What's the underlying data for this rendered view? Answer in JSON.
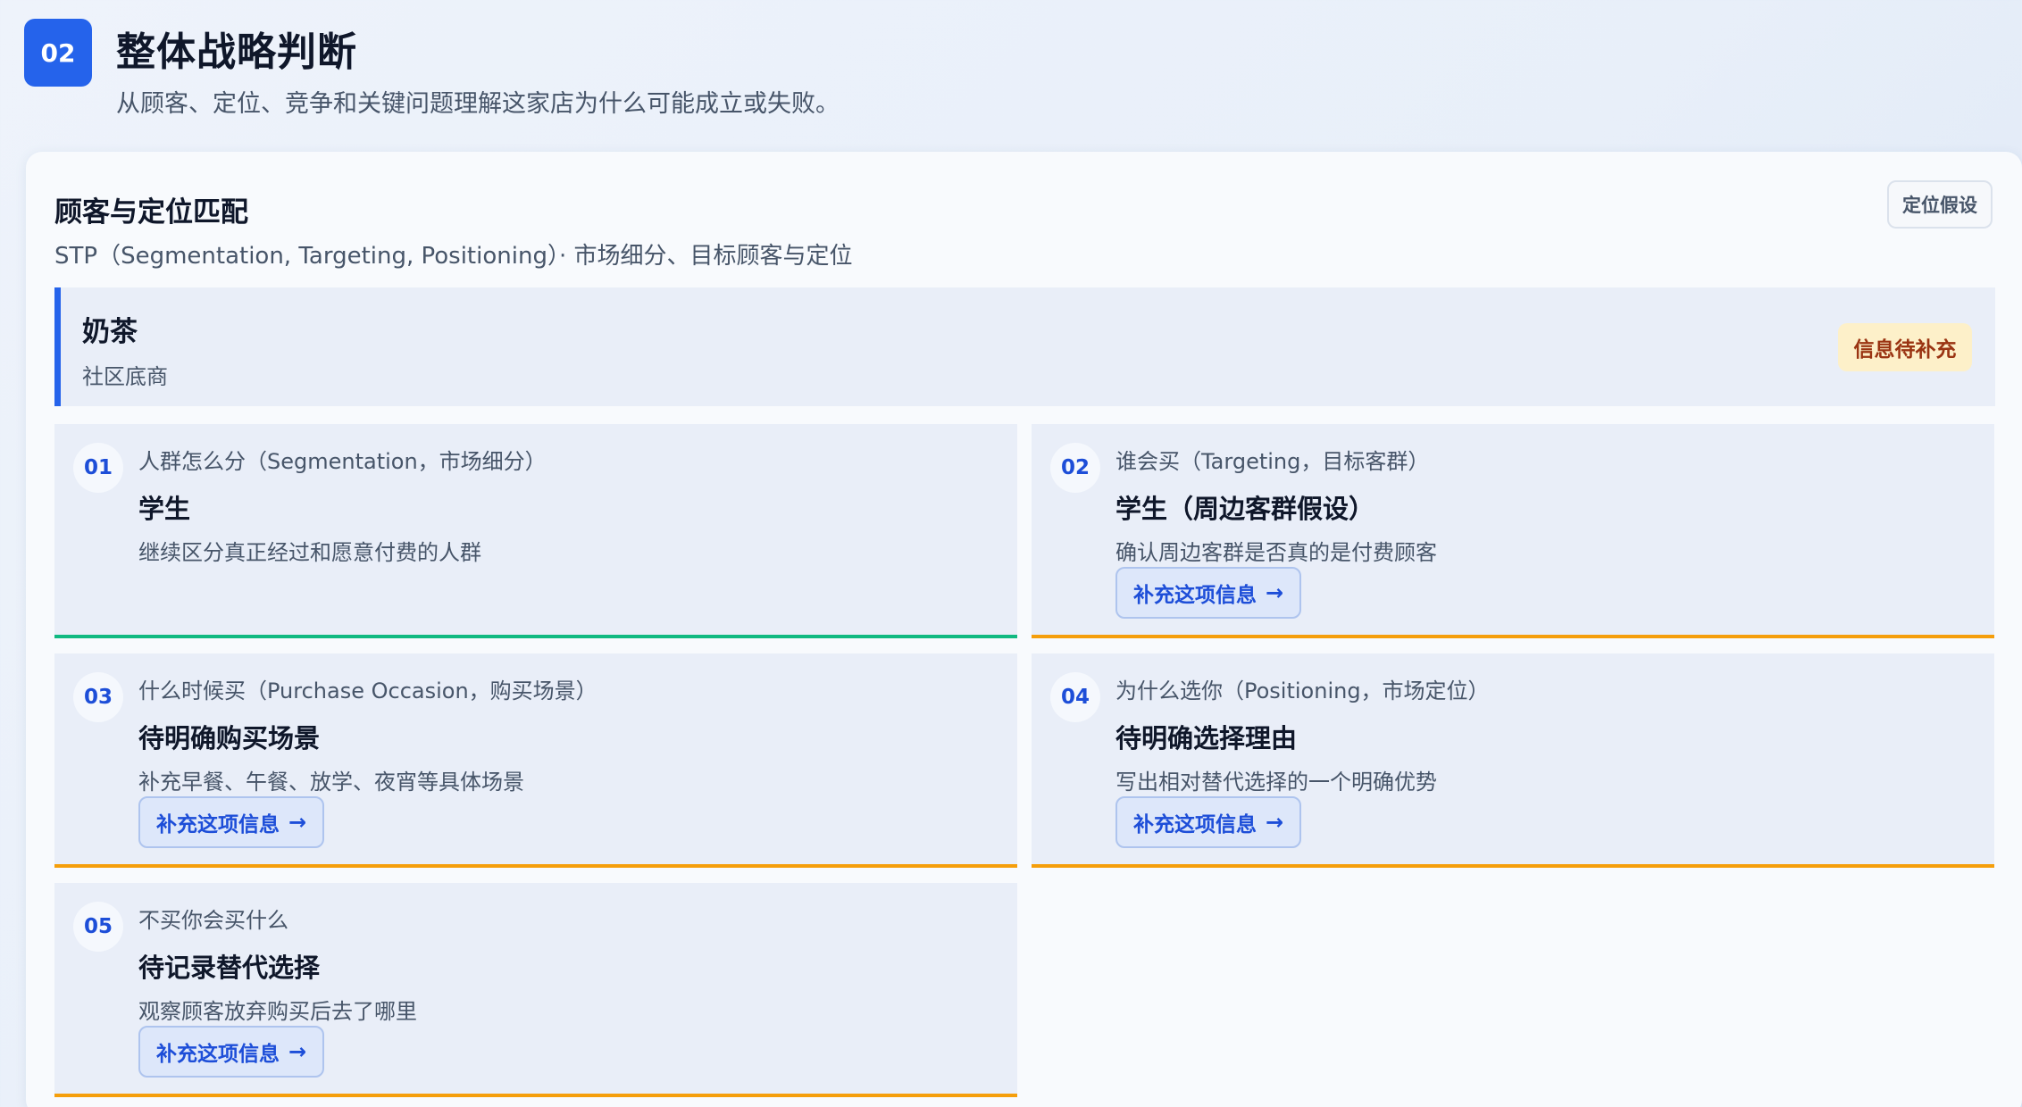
{
  "header": {
    "badge": "02",
    "title": "整体战略判断",
    "subtitle": "从顾客、定位、竞争和关键问题理解这家店为什么可能成立或失败。"
  },
  "card": {
    "title": "顾客与定位匹配",
    "subtitle": "STP（Segmentation, Targeting, Positioning）· 市场细分、目标顾客与定位",
    "tag": "定位假设"
  },
  "store": {
    "name": "奶茶",
    "location": "社区底商",
    "status": "信息待补充"
  },
  "questions": [
    {
      "number": "01",
      "label": "人群怎么分（Segmentation，市场细分）",
      "answer": "学生",
      "hint": "继续区分真正经过和愿意付费的人群",
      "button": "",
      "status": "filled"
    },
    {
      "number": "02",
      "label": "谁会买（Targeting，目标客群）",
      "answer": "学生（周边客群假设）",
      "hint": "确认周边客群是否真的是付费顾客",
      "button": "补充这项信息",
      "status": "pending"
    },
    {
      "number": "03",
      "label": "什么时候买（Purchase Occasion，购买场景）",
      "answer": "待明确购买场景",
      "hint": "补充早餐、午餐、放学、夜宵等具体场景",
      "button": "补充这项信息",
      "status": "pending"
    },
    {
      "number": "04",
      "label": "为什么选你（Positioning，市场定位）",
      "answer": "待明确选择理由",
      "hint": "写出相对替代选择的一个明确优势",
      "button": "补充这项信息",
      "status": "pending"
    },
    {
      "number": "05",
      "label": "不买你会买什么",
      "answer": "待记录替代选择",
      "hint": "观察顾客放弃购买后去了哪里",
      "button": "补充这项信息",
      "status": "pending"
    }
  ],
  "icons": {
    "arrow": "→",
    "arrow_name": "arrow-right-icon"
  },
  "colors": {
    "accent": "#2563eb",
    "filled_line": "#10b981",
    "pending_line": "#f59e0b",
    "status_badge_bg": "#fdf0c9",
    "status_badge_text": "#9a3412"
  }
}
